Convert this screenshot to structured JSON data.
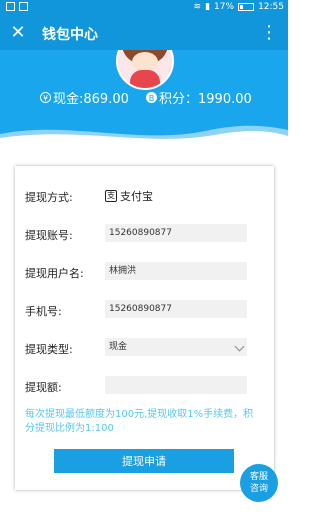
{
  "status_bar": {
    "battery": "17%",
    "time": "12:55",
    "icons": [
      "wechat-icon",
      "image-icon",
      "wifi-icon",
      "signal-icon",
      "battery-icon"
    ]
  },
  "header": {
    "title": "钱包中心",
    "close_icon": "close-icon",
    "more_icon": "more-vertical-icon"
  },
  "summary": {
    "cash_icon_glyph": "¥",
    "cash_label": "现金:869.00",
    "points_icon_glyph": "B",
    "points_label": "积分：1990.00"
  },
  "form": {
    "method_label": "提现方式:",
    "method_value": "支付宝",
    "method_icon_glyph": "支",
    "account_label": "提现账号:",
    "account_value": "15260890877",
    "username_label": "提现用户名:",
    "username_value": "林拥洪",
    "phone_label": "手机号:",
    "phone_value": "15260890877",
    "type_label": "提现类型:",
    "type_value": "现金",
    "amount_label": "提现额:",
    "amount_value": "",
    "note": "每次提现最低额度为100元,提现收取1%手续费，积分提现比例为1:100",
    "submit_label": "提现申请"
  },
  "service": {
    "line1": "客服",
    "line2": "咨询"
  },
  "colors": {
    "primary": "#1296db",
    "banner": "#19a6ec",
    "note": "#55c8f0",
    "button": "#1a9fe2"
  }
}
